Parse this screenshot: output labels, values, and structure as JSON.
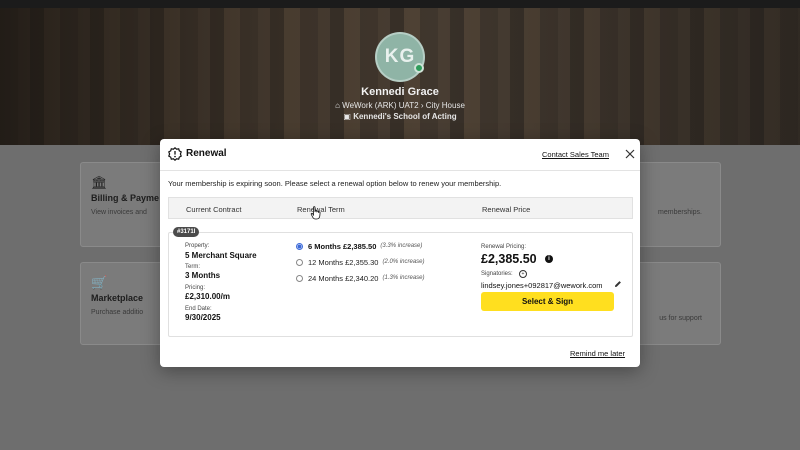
{
  "profile": {
    "initials": "KG",
    "name": "Kennedi Grace",
    "location_org": "WeWork (ARK) UAT2",
    "location_site": "City House",
    "company": "Kennedi's School of Acting"
  },
  "background_cards": {
    "billing_title": "Billing & Payme",
    "billing_sub": "View invoices and",
    "memberships_sub": "memberships.",
    "marketplace_title": "Marketplace",
    "marketplace_sub": "Purchase additio",
    "support_sub": "us for support"
  },
  "modal": {
    "title": "Renewal",
    "contact_link": "Contact Sales Team",
    "notice": "Your membership is expiring soon. Please select a renewal option below to renew your membership.",
    "columns": [
      "Current Contract",
      "Renewal Term",
      "Renewal Price"
    ],
    "contract": {
      "badge": "#3171I",
      "property_label": "Property:",
      "property_value": "5 Merchant Square",
      "term_label": "Term:",
      "term_value": "3 Months",
      "pricing_label": "Pricing:",
      "pricing_value": "£2,310.00/m",
      "end_label": "End Date:",
      "end_value": "9/30/2025"
    },
    "options": [
      {
        "label": "6 Months £2,385.50",
        "note": "(3.3% increase)",
        "selected": true
      },
      {
        "label": "12 Months £2,355.30",
        "note": "(2.0% increase)",
        "selected": false
      },
      {
        "label": "24 Months £2,340.20",
        "note": "(1.3% increase)",
        "selected": false
      }
    ],
    "renewal_pricing_label": "Renewal Pricing:",
    "renewal_price": "£2,385.50",
    "signatories_label": "Signatories:",
    "signatory_email": "lindsey.jones+092817@wework.com",
    "select_sign_button": "Select & Sign",
    "remind_link": "Remind me later"
  },
  "colors": {
    "accent_button": "#ffdf1f",
    "radio_selected": "#3c6ad8",
    "online_status": "#2f9d5c",
    "avatar_bg": "#8fb4a6"
  },
  "icons": [
    "home-icon",
    "chevron-right-icon",
    "briefcase-icon",
    "settings-badge-icon",
    "close-icon",
    "info-icon",
    "add-signatory-icon",
    "pencil-icon",
    "bank-icon",
    "cart-icon",
    "hand-cursor-icon"
  ]
}
